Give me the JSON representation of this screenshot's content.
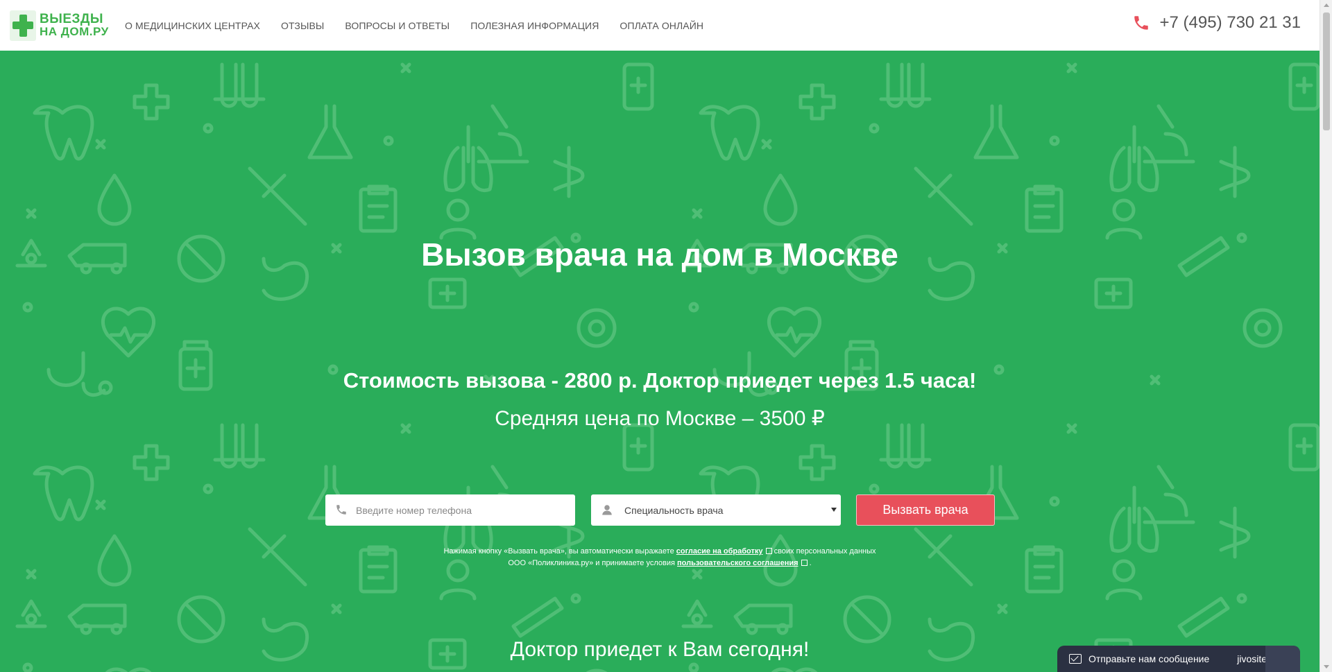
{
  "header": {
    "logo": {
      "line1": "ВЫЕЗДЫ",
      "line2": "НА ДОМ.РУ"
    },
    "nav": [
      "О МЕДИЦИНСКИХ ЦЕНТРАХ",
      "ОТЗЫВЫ",
      "ВОПРОСЫ И ОТВЕТЫ",
      "ПОЛЕЗНАЯ ИНФОРМАЦИЯ",
      "ОПЛАТА ОНЛАЙН"
    ],
    "phone": "+7 (495) 730 21 31"
  },
  "hero": {
    "title": "Вызов врача на дом в Москве",
    "subtitle": "Стоимость вызова - 2800 р. Доктор приедет через 1.5 часа!",
    "price": "Средняя цена по Москве – 3500 ₽",
    "form": {
      "phone_placeholder": "Введите номер телефона",
      "specialty_value": "Специальность врача",
      "submit_label": "Вызвать врача"
    },
    "consent": {
      "text1": "Нажимая кнопку «Вызвать врача», вы автоматически выражаете",
      "link1": "согласие на обработку",
      "text2": "своих персональных данных",
      "text3": "ООО «Поликлиника.ру» и принимаете условия",
      "link2": "пользовательского соглашения",
      "text4": "."
    },
    "bottom_title": "Доктор приедет к Вам сегодня!"
  },
  "chat": {
    "label": "Отправьте нам сообщение",
    "brand": "jivosite"
  },
  "colors": {
    "brand_green": "#2aad5a",
    "logo_green": "#3fb24d",
    "accent_red": "#e8505b",
    "chat_dark": "#2b3142"
  },
  "icons": [
    "phone-icon",
    "user-icon",
    "envelope-icon",
    "external-link-icon",
    "medical-pattern"
  ]
}
